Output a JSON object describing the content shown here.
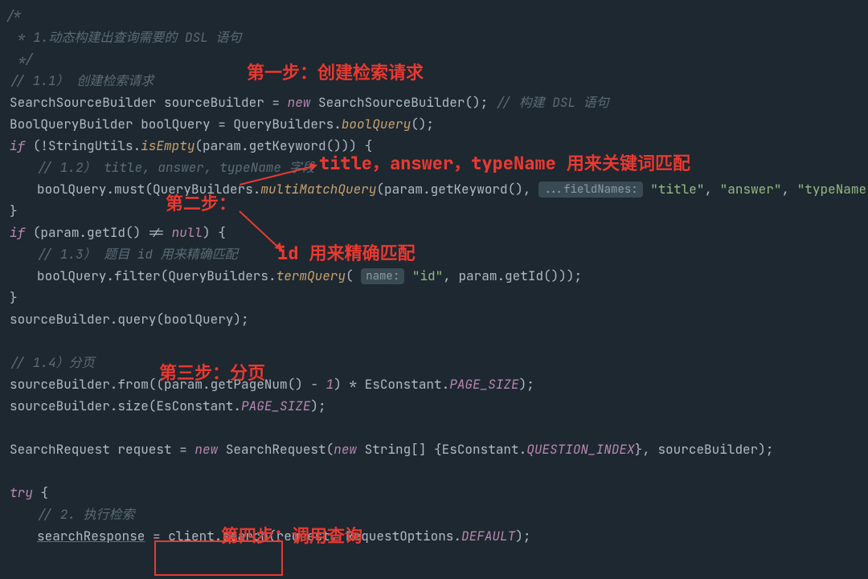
{
  "annotations": {
    "step1": "第一步：创建检索请求",
    "multimatch": "title，answer，typeName 用来关键词匹配",
    "step2": "第二步：",
    "idmatch": "id 用来精确匹配",
    "step3": "第三步：分页",
    "step4": "第四步：调用查询"
  },
  "hints": {
    "fieldNames": "...fieldNames:",
    "name": "name:"
  },
  "lines": {
    "l1": "/*",
    "l2_a": "* 1.动态构建出查询需要的 DSL 语句",
    "l3": "*/",
    "l4": "// 1.1） 创建检索请求",
    "l5_builder": "SearchSourceBuilder sourceBuilder = ",
    "l5_new": "new ",
    "l5_ctor": "SearchSourceBuilder(); ",
    "l5_comment": "// 构建 DSL 语句",
    "l6_a": "BoolQueryBuilder boolQuery = QueryBuilders.",
    "l6_m": "boolQuery",
    "l6_e": "();",
    "l7_if": "if ",
    "l7_a": "(!StringUtils.",
    "l7_m": "isEmpty",
    "l7_b": "(param.getKeyword())) {",
    "l8_c": "// 1.2） title, answer, typeName 字段",
    "l9_a": "boolQuery.must(QueryBuilders.",
    "l9_m": "multiMatchQuery",
    "l9_b": "(param.getKeyword(),",
    "l9_s1": "\"title\"",
    "l9_s2": "\"answer\"",
    "l9_s3": "\"typeName\"",
    "l9_e": "));",
    "l10": "}",
    "l11_if": "if ",
    "l11_a": "(param.getId() != ",
    "l11_null": "null",
    "l11_b": ") {",
    "l12_c": "// 1.3） 题目 id 用来精确匹配",
    "l13_a": "boolQuery.filter(QueryBuilders.",
    "l13_m": "termQuery",
    "l13_b": "(",
    "l13_s": "\"id\"",
    "l13_c2": ", param.getId()));",
    "l14": "}",
    "l15": "sourceBuilder.query(boolQuery);",
    "l17_c": "// 1.4）分页",
    "l18_a": "sourceBuilder.from((param.getPageNum() - ",
    "l18_n": "1",
    "l18_b": ") * EsConstant.",
    "l18_const": "PAGE_SIZE",
    "l18_e": ");",
    "l19_a": "sourceBuilder.size(EsConstant.",
    "l19_const": "PAGE_SIZE",
    "l19_e": ");",
    "l21_a": "SearchRequest request = ",
    "l21_new": "new ",
    "l21_b": "SearchRequest(",
    "l21_new2": "new ",
    "l21_c": "String[] {EsConstant.",
    "l21_const": "QUESTION_INDEX",
    "l21_d": "}, sourceBuilder);",
    "l23_try": "try ",
    "l23_b": "{",
    "l24_c": "// 2. 执行检索",
    "l25_a": "searchResponse",
    "l25_b": " = client.search(request, RequestOptions.",
    "l25_const": "DEFAULT",
    "l25_e": ");"
  }
}
